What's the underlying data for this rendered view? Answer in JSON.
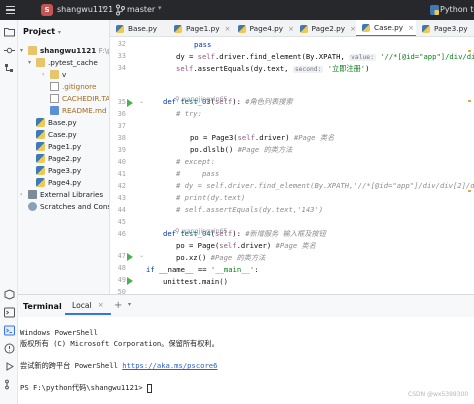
{
  "titlebar": {
    "project_badge": "S",
    "project_name": "shangwu1121",
    "branch": "master",
    "run_config": "Python tes"
  },
  "project_panel": {
    "title": "Project",
    "items": [
      {
        "label": "shangwu1121",
        "extra": "F:\\py",
        "type": "folder",
        "depth": 0,
        "caret": "open"
      },
      {
        "label": ".pytest_cache",
        "type": "folder",
        "depth": 1,
        "caret": "open"
      },
      {
        "label": "v",
        "type": "folder",
        "depth": 2,
        "caret": "closed"
      },
      {
        "label": ".gitignore",
        "type": "git",
        "depth": 2
      },
      {
        "label": "CACHEDIR.TA",
        "type": "git",
        "depth": 2
      },
      {
        "label": "README.md",
        "type": "md",
        "depth": 2
      },
      {
        "label": "Base.py",
        "type": "py",
        "depth": 1
      },
      {
        "label": "Case.py",
        "type": "py",
        "depth": 1
      },
      {
        "label": "Page1.py",
        "type": "py",
        "depth": 1
      },
      {
        "label": "Page2.py",
        "type": "py",
        "depth": 1
      },
      {
        "label": "Page3.py",
        "type": "py",
        "depth": 1
      },
      {
        "label": "Page4.py",
        "type": "py",
        "depth": 1
      },
      {
        "label": "External Libraries",
        "type": "extlib",
        "depth": 0,
        "caret": "closed"
      },
      {
        "label": "Scratches and Cons",
        "type": "scratch",
        "depth": 0
      }
    ]
  },
  "tabs": [
    {
      "label": "Base.py",
      "active": false
    },
    {
      "label": "Page1.py",
      "active": false
    },
    {
      "label": "Page4.py",
      "active": false
    },
    {
      "label": "Page2.py",
      "active": false
    },
    {
      "label": "Case.py",
      "active": true
    },
    {
      "label": "Page3.py",
      "active": false
    }
  ],
  "tab_close_glyph": "×",
  "editor": {
    "line_numbers": [
      "32",
      "33",
      "34",
      "35",
      "36",
      "37",
      "38",
      "39",
      "40",
      "41",
      "42",
      "43",
      "44",
      "45",
      "46",
      "47",
      "48",
      "49",
      "50"
    ],
    "code_lines": {
      "l32": "pass",
      "l33_a": "dy = ",
      "l33_self": "self",
      "l33_b": ".driver.find_element(By.XPATH,",
      "l33_hint": "value:",
      "l33_str": "'//*[@id=\"app\"]/div/div[2]/div",
      "l34_self": "self",
      "l34_a": ".assertEquals(dy.text,",
      "l34_hint": "second:",
      "l34_str": "'立即注册'",
      "l34_c": ")",
      "author1": "wangjingxin65",
      "l35_kw": "def",
      "l35_name": "test_03",
      "l35_self": "self",
      "l35_cmt": "#角色列表搜索",
      "l36": "# try:",
      "l38_a": "po = Page3(",
      "l38_self": "self",
      "l38_b": ".driver)",
      "l38_cmt": "#Page 类名",
      "l39_a": "po.dlslb()",
      "l39_cmt": "#Page 的类方法",
      "l40": "# except:",
      "l41": "#     pass",
      "l42": "# dy = self.driver.find_element(By.XPATH,'//*[@id=\"app\"]/div/div[2]/div/",
      "l43": "# print(dy.text)",
      "l44": "# self.assertEquals(dy.text,'143')",
      "author2": "wangjingxin65",
      "l46_kw": "def",
      "l46_name": "test_04",
      "l46_self": "self",
      "l46_cmt": "#新增服务 输入框及按钮",
      "l47_a": "po = Page(",
      "l47_self": "self",
      "l47_b": ".driver)",
      "l47_cmt": "#Page 类名",
      "l48_a": "po.xz()",
      "l48_cmt": "#Page 的类方法",
      "l49_kw": "if",
      "l49_a": " __name__ == ",
      "l49_str": "'__main__'",
      "l49_b": ":",
      "l50": "unittest.main()"
    }
  },
  "terminal": {
    "title": "Terminal",
    "tab_label": "Local",
    "add_glyph": "+",
    "lines": {
      "t1": "Windows PowerShell",
      "t2": "版权所有 (C) Microsoft Corporation。保留所有权利。",
      "t3_a": "尝试新的跨平台 PowerShell ",
      "t3_link": "https://aka.ms/pscore6",
      "t4": "PS F:\\python代码\\shangwu1121> "
    }
  },
  "watermark": "CSDN @wx5399300",
  "colors": {
    "accent": "#3574f0",
    "run_green": "#4caf50",
    "keyword": "#0033b3",
    "string": "#067d17",
    "comment": "#8c8c8c",
    "self_kw": "#94558d"
  }
}
